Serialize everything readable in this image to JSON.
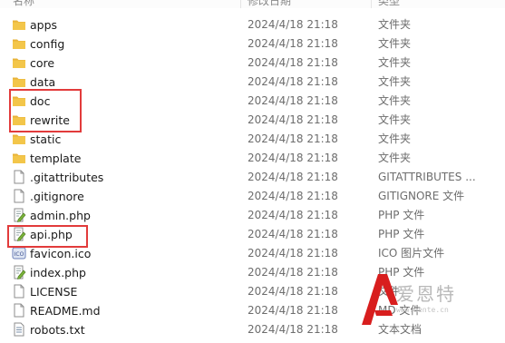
{
  "header": {
    "name": "名称",
    "date": "修改日期",
    "type": "类型"
  },
  "files": [
    {
      "name": "apps",
      "date": "2024/4/18 21:18",
      "type": "文件夹",
      "icon": "folder-icon"
    },
    {
      "name": "config",
      "date": "2024/4/18 21:18",
      "type": "文件夹",
      "icon": "folder-icon"
    },
    {
      "name": "core",
      "date": "2024/4/18 21:18",
      "type": "文件夹",
      "icon": "folder-icon"
    },
    {
      "name": "data",
      "date": "2024/4/18 21:18",
      "type": "文件夹",
      "icon": "folder-icon"
    },
    {
      "name": "doc",
      "date": "2024/4/18 21:18",
      "type": "文件夹",
      "icon": "folder-icon"
    },
    {
      "name": "rewrite",
      "date": "2024/4/18 21:18",
      "type": "文件夹",
      "icon": "folder-icon"
    },
    {
      "name": "static",
      "date": "2024/4/18 21:18",
      "type": "文件夹",
      "icon": "folder-icon"
    },
    {
      "name": "template",
      "date": "2024/4/18 21:18",
      "type": "文件夹",
      "icon": "folder-icon"
    },
    {
      "name": ".gitattributes",
      "date": "2024/4/18 21:18",
      "type": "GITATTRIBUTES ...",
      "icon": "file-icon"
    },
    {
      "name": ".gitignore",
      "date": "2024/4/18 21:18",
      "type": "GITIGNORE 文件",
      "icon": "file-icon"
    },
    {
      "name": "admin.php",
      "date": "2024/4/18 21:18",
      "type": "PHP 文件",
      "icon": "php-file-icon"
    },
    {
      "name": "api.php",
      "date": "2024/4/18 21:18",
      "type": "PHP 文件",
      "icon": "php-file-icon"
    },
    {
      "name": "favicon.ico",
      "date": "2024/4/18 21:18",
      "type": "ICO 图片文件",
      "icon": "ico-file-icon"
    },
    {
      "name": "index.php",
      "date": "2024/4/18 21:18",
      "type": "PHP 文件",
      "icon": "php-file-icon"
    },
    {
      "name": "LICENSE",
      "date": "2024/4/18 21:18",
      "type": "文件",
      "icon": "file-icon"
    },
    {
      "name": "README.md",
      "date": "2024/4/18 21:18",
      "type": "MD 文件",
      "icon": "file-icon"
    },
    {
      "name": "robots.txt",
      "date": "2024/4/18 21:18",
      "type": "文本文档",
      "icon": "text-file-icon"
    }
  ],
  "highlights": [
    "doc",
    "rewrite",
    "api.php"
  ],
  "watermark": {
    "text": "爱恩特",
    "url": "www.aente.cn"
  },
  "colors": {
    "folder": "#f3c64a",
    "highlight": "#e23b3b",
    "watermark_red": "#d81e1e"
  }
}
